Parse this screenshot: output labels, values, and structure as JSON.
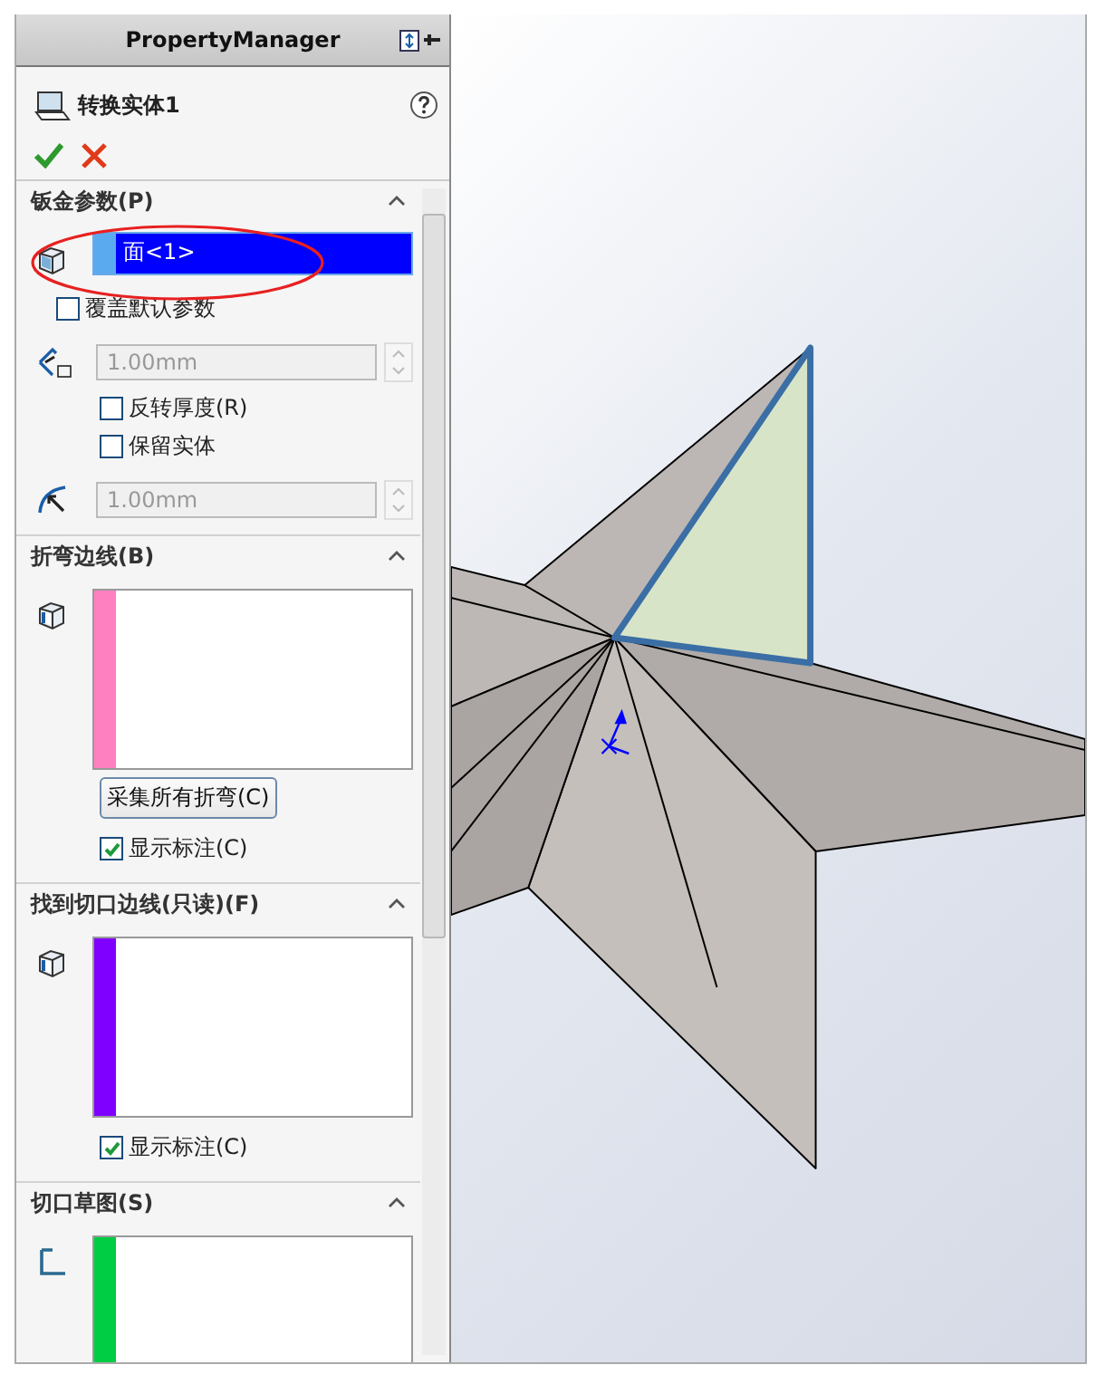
{
  "panel": {
    "header": "PropertyManager",
    "feature_title": "转换实体1"
  },
  "sections": [
    {
      "kind": "params",
      "title": "钣金参数(P)",
      "expanded": true,
      "selection": {
        "value": "面<1>",
        "color": "#5aaaf0",
        "selected": true
      },
      "override": {
        "label": "覆盖默认参数",
        "checked": false
      },
      "thickness": {
        "value": "1.00mm",
        "disabled": true
      },
      "options": [
        {
          "label": "反转厚度(R)",
          "checked": false
        },
        {
          "label": "保留实体",
          "checked": false
        }
      ],
      "radius": {
        "value": "1.00mm",
        "disabled": true
      }
    },
    {
      "kind": "edges",
      "title": "折弯边线(B)",
      "expanded": true,
      "color": "#ff80c0",
      "button": "采集所有折弯(C)",
      "callouts": {
        "label": "显示标注(C)",
        "checked": true
      }
    },
    {
      "kind": "edges",
      "title": "找到切口边线(只读)(F)",
      "expanded": true,
      "color": "#8000ff",
      "callouts": {
        "label": "显示标注(C)",
        "checked": true
      }
    },
    {
      "kind": "sketch",
      "title": "切口草图(S)",
      "expanded": true,
      "color": "#00cc44"
    }
  ]
}
